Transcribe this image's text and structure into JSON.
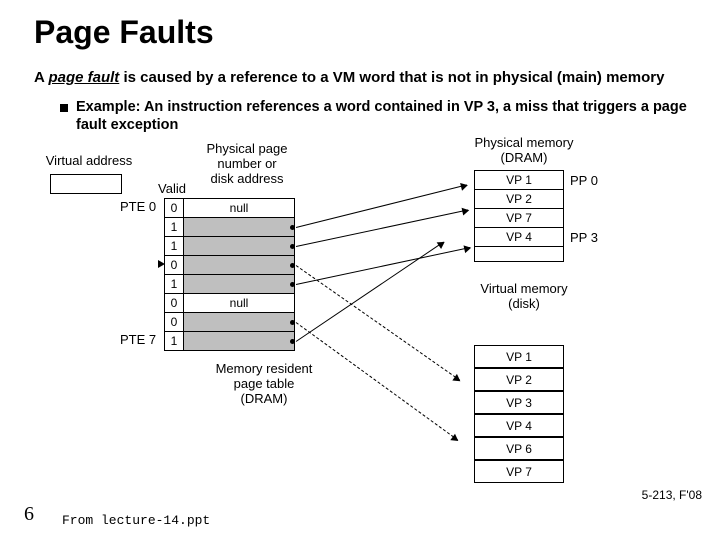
{
  "title": "Page Faults",
  "definition_pre": "A ",
  "definition_pf": "page fault",
  "definition_post": " is caused by a reference to a VM word that is not in physical (main) memory",
  "example": "Example: An instruction references a word contained in VP 3, a miss that triggers a page fault exception",
  "labels": {
    "va": "Virtual address",
    "valid": "Valid",
    "ppda": "Physical page\nnumber or\ndisk address",
    "pte0": "PTE 0",
    "pte7": "PTE 7",
    "mrpt": "Memory resident\npage table\n(DRAM)",
    "pm": "Physical memory\n(DRAM)",
    "vm": "Virtual memory\n(disk)"
  },
  "page_table": [
    {
      "valid": "0",
      "addr": "null",
      "gray": false
    },
    {
      "valid": "1",
      "addr": "",
      "gray": true
    },
    {
      "valid": "1",
      "addr": "",
      "gray": true
    },
    {
      "valid": "0",
      "addr": "",
      "gray": true
    },
    {
      "valid": "1",
      "addr": "",
      "gray": true
    },
    {
      "valid": "0",
      "addr": "null",
      "gray": false
    },
    {
      "valid": "0",
      "addr": "",
      "gray": true
    },
    {
      "valid": "1",
      "addr": "",
      "gray": true
    }
  ],
  "phys_mem": {
    "rows": [
      "VP 1",
      "VP 2",
      "VP 7",
      "VP 4"
    ],
    "pp": [
      "PP 0",
      "PP 3"
    ]
  },
  "disk": [
    "VP 1",
    "VP 2",
    "VP 3",
    "VP 4",
    "VP 6",
    "VP 7"
  ],
  "slide_number": "6",
  "source": "From lecture-14.ppt",
  "footer": "5-213, F'08"
}
